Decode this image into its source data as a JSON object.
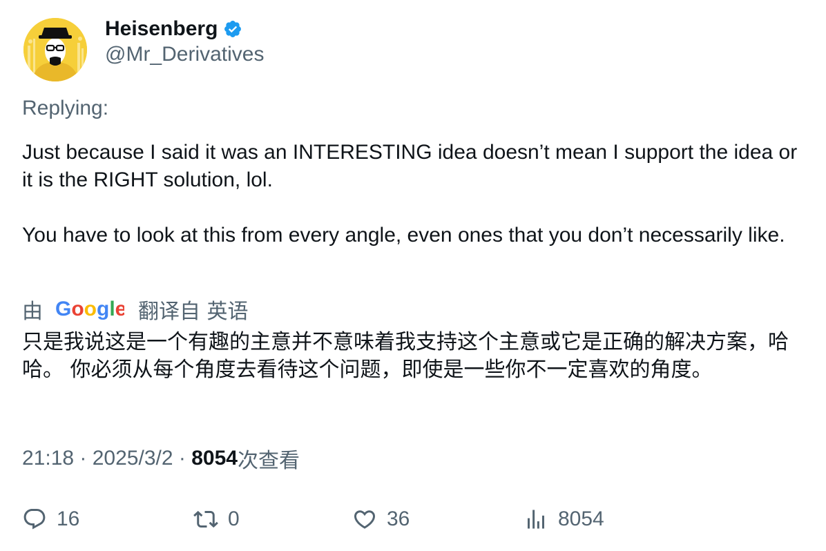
{
  "author": {
    "display_name": "Heisenberg",
    "handle": "@Mr_Derivatives",
    "verified": true,
    "verified_color": "#1d9bf0",
    "avatar_icon": "heisenberg-avatar"
  },
  "replying_label": "Replying:",
  "tweet": {
    "paragraph_1": "Just because I said it was an INTERESTING idea doesn’t mean I support the idea or it is the RIGHT solution, lol.",
    "paragraph_2": "You have to look at this from every angle, even ones that you don’t necessarily like."
  },
  "translation": {
    "prefix": "由",
    "provider": "Google",
    "suffix": "翻译自 英语",
    "text": "只是我说这是一个有趣的主意并不意味着我支持这个主意或它是正确的解决方案，哈哈。 你必须从每个角度去看待这个问题，即使是一些你不一定喜欢的角度。"
  },
  "meta": {
    "time": "21:18",
    "separator": " · ",
    "date": "2025/3/2",
    "views_count": "8054",
    "views_label": "次查看"
  },
  "actions": {
    "replies": "16",
    "retweets": "0",
    "likes": "36",
    "views": "8054"
  },
  "colors": {
    "text_primary": "#0f1419",
    "text_secondary": "#536471",
    "google_blue": "#4285F4",
    "google_red": "#EA4335",
    "google_yellow": "#FBBC05",
    "google_green": "#34A853"
  }
}
